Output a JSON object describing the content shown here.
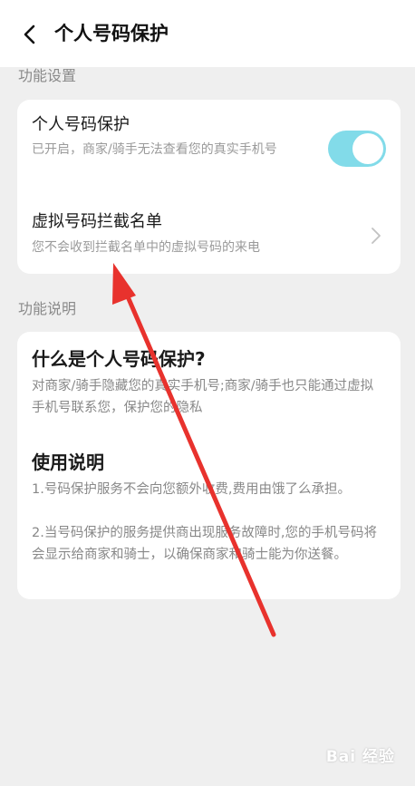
{
  "header": {
    "title": "个人号码保护",
    "back_icon": "chevron-left-icon"
  },
  "sections": {
    "settings_label": "功能设置",
    "info_label": "功能说明"
  },
  "settings": {
    "protection": {
      "title": "个人号码保护",
      "subtitle": "已开启，商家/骑手无法查看您的真实手机号",
      "toggle_on": true
    },
    "block_list": {
      "title": "虚拟号码拦截名单",
      "subtitle": "您不会收到拦截名单中的虚拟号码的来电"
    }
  },
  "info": {
    "what_title": "什么是个人号码保护?",
    "what_body": "对商家/骑手隐藏您的真实手机号;商家/骑手也只能通过虚拟手机号联系您，保护您的隐私",
    "usage_title": "使用说明",
    "usage_item1": "1.号码保护服务不会向您额外收费,费用由饿了么承担。",
    "usage_item2": "2.当号码保护的服务提供商出现服务故障时,您的手机号码将会显示给商家和骑士，以确保商家和骑士能为你送餐。"
  },
  "colors": {
    "toggle_on": "#82dbe9",
    "annotation_arrow": "#e8322d",
    "background": "#efefef"
  },
  "watermark": "Bai 经验"
}
